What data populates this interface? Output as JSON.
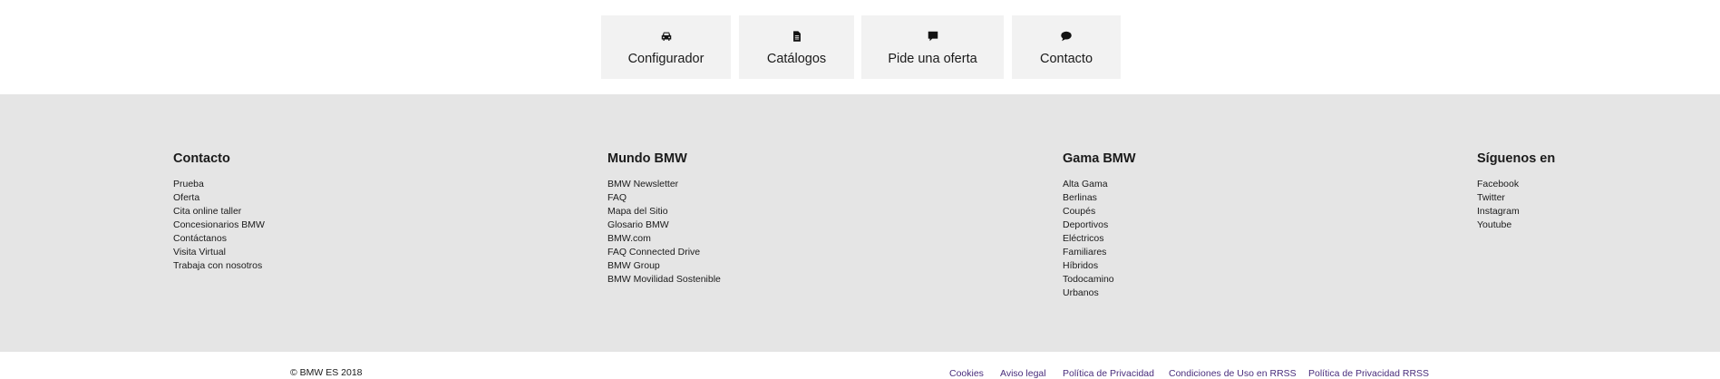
{
  "quick_links": [
    {
      "label": "Configurador",
      "icon": "car-icon"
    },
    {
      "label": "Catálogos",
      "icon": "document-icon"
    },
    {
      "label": "Pide una oferta",
      "icon": "comment-icon"
    },
    {
      "label": "Contacto",
      "icon": "chat-bubble-icon"
    }
  ],
  "footer": {
    "columns": [
      {
        "title": "Contacto",
        "items": [
          "Prueba",
          "Oferta",
          "Cita online taller",
          "Concesionarios BMW",
          "Contáctanos",
          "Visita Virtual",
          "Trabaja con nosotros"
        ]
      },
      {
        "title": "Mundo BMW",
        "items": [
          "BMW Newsletter",
          "FAQ",
          "Mapa del Sitio",
          "Glosario BMW",
          "BMW.com",
          "FAQ Connected Drive",
          "BMW Group",
          "BMW Movilidad Sostenible"
        ]
      },
      {
        "title": "Gama BMW",
        "items": [
          "Alta Gama",
          "Berlinas",
          "Coupés",
          "Deportivos",
          "Eléctricos",
          "Familiares",
          "Híbridos",
          "Todocamino",
          "Urbanos"
        ]
      },
      {
        "title": "Síguenos en",
        "items": [
          "Facebook",
          "Twitter",
          "Instagram",
          "Youtube"
        ]
      }
    ],
    "copyright": "© BMW ES 2018",
    "legal_links": [
      "Cookies",
      "Aviso legal",
      "Política de Privacidad",
      "Condiciones de Uso en RRSS",
      "Política de Privacidad RRSS"
    ]
  },
  "colors": {
    "link_purple": "#4a2d7c",
    "footer_bg": "#e5e5e5",
    "button_bg": "#f2f2f2"
  }
}
